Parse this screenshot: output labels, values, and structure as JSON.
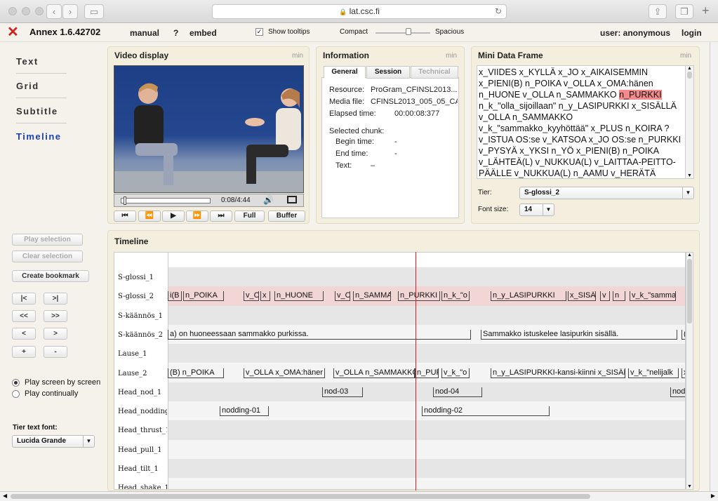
{
  "browser": {
    "url": "lat.csc.fi"
  },
  "app": {
    "name": "Annex 1.6.42702",
    "user": "user: anonymous",
    "login": "login"
  },
  "menu": {
    "manual": "manual",
    "help": "?",
    "embed": "embed",
    "show_tooltips": "Show tooltips",
    "compact": "Compact",
    "spacious": "Spacious"
  },
  "nav": [
    "Text",
    "Grid",
    "Subtitle",
    "Timeline"
  ],
  "left_controls": {
    "play_selection": "Play selection",
    "clear_selection": "Clear selection",
    "create_bookmark": "Create bookmark",
    "nav_buttons": [
      "|<",
      ">|",
      "<<",
      ">>",
      "<",
      ">",
      "+",
      "-"
    ],
    "play_screen": "Play screen by screen",
    "play_continually": "Play continually",
    "tier_text_font_label": "Tier text font:",
    "tier_text_font": "Lucida Grande"
  },
  "video": {
    "title": "Video display",
    "min": "min",
    "time": "0:08/4:44",
    "buttons": [
      "⏮",
      "⏪",
      "▶",
      "⏩",
      "⏭",
      "Full",
      "Buffer"
    ]
  },
  "info": {
    "title": "Information",
    "min": "min",
    "tabs": [
      "General",
      "Session",
      "Technical"
    ],
    "resource_label": "Resource:",
    "resource": "ProGram_CFINSL2013...",
    "media_label": "Media file:",
    "media": "CFINSL2013_005_05_CA",
    "elapsed_label": "Elapsed time:",
    "elapsed": "00:00:08:377",
    "selected_chunk": "Selected chunk:",
    "begin_label": "Begin time:",
    "begin": "-",
    "end_label": "End time:",
    "end": "-",
    "text_label": "Text:",
    "text": "–"
  },
  "mini": {
    "title": "Mini Data Frame",
    "min": "min",
    "before": "x_VIIDES x_KYLLÄ x_JO x_AIKAISEMMIN x_PIENI(B) n_POIKA v_OLLA x_OMA:hänen n_HUONE v_OLLA n_SAMMAKKO ",
    "highlight": "n_PURKKI",
    "after": " n_k_\"olla_sijoillaan\" n_y_LASIPURKKI x_SISÄLLÄ v_OLLA n_SAMMAKKO v_k_\"sammakko_kyyhöttää\" x_PLUS n_KOIRA ? v_ISTUA OS:se v_KATSOA x_JO OS:se n_PURKKI v_PYSYÄ x_YKSI n_YÖ x_PIENI(B) n_POIKA v_LÄHTEÄ(L) v_NUKKUA(L) v_LAITTAA-PEITTO-PÄÄLLE v_NUKKUA(L) n_AAMU v_HERÄTÄ",
    "tier_label": "Tier:",
    "tier": "S-glossi_2",
    "font_label": "Font size:",
    "font_size": "14"
  },
  "timeline": {
    "title": "Timeline",
    "tiers": [
      "S-glossi_1",
      "S-glossi_2",
      "S-käännös_1",
      "S-käännös_2",
      "Lause_1",
      "Lause_2",
      "Head_nod_1",
      "Head_nodding_",
      "Head_thrust_1",
      "Head_pull_1",
      "Head_tilt_1",
      "Head_shake_1"
    ],
    "segments": {
      "sg2": [
        "i(B",
        "n_POIKA",
        "v_C",
        "x",
        "n_HUONE",
        "v_C",
        "n_SAMMA",
        "n_PURKKI",
        "n_k_\"o",
        "n_y_LASIPURKKI",
        "x_SISÄ",
        "v",
        "n",
        "v_k_\"samma"
      ],
      "sk2": [
        "a) on huoneessaan sammakko purkissa.",
        "Sammakko istuskelee lasipurkin sisällä.",
        "("
      ],
      "l2": [
        "(B) n_POIKA",
        "v_OLLA x_OMA:häner",
        "v_OLLA n_SAMMAKKO",
        "n_PUR",
        "v_k_\"o",
        "n_y_LASIPURKKI-kansi-kiinni x_SISÄLI",
        "v_k_\"nelijalk",
        "x"
      ],
      "nod": [
        "nod-03",
        "nod-04",
        "nod"
      ],
      "nodding": [
        "nodding-01",
        "nodding-02"
      ]
    }
  },
  "colors": {
    "accent": "#d02020",
    "nav_active": "#1a3fb0",
    "highlight_row": "#f2d6d6",
    "cursor": "#cc2222"
  }
}
